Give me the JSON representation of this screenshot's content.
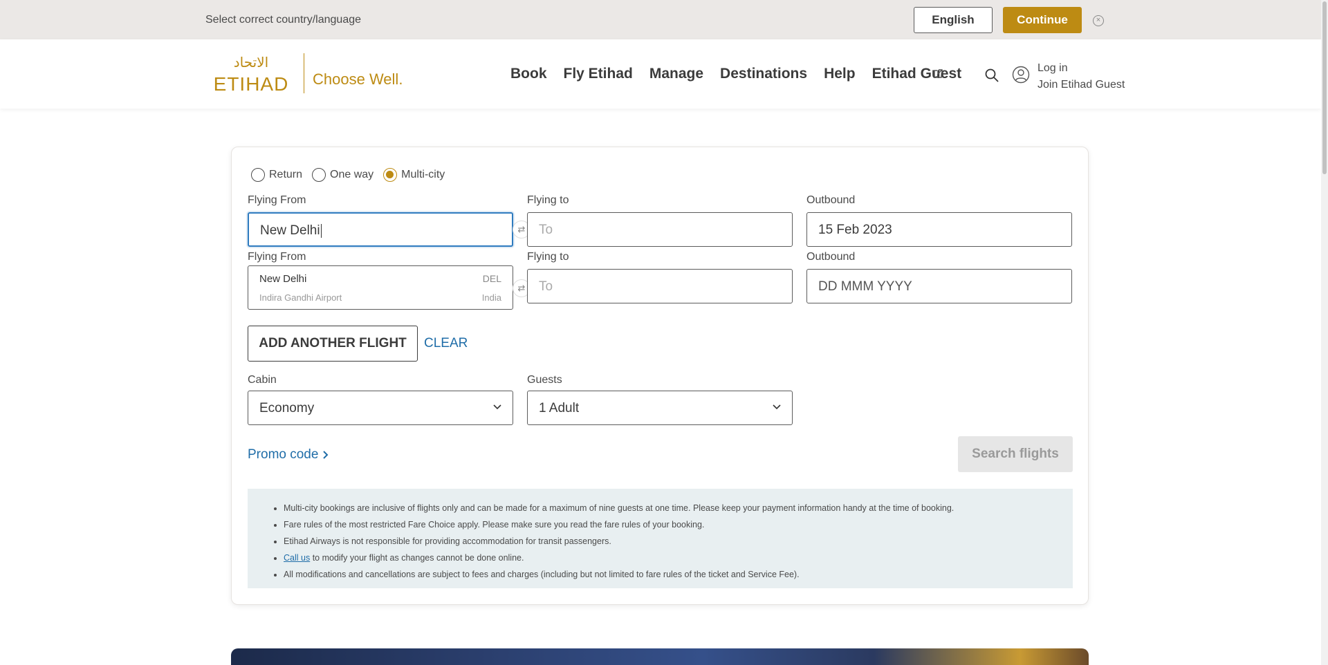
{
  "banner": {
    "message": "Select correct country/language",
    "language_button": "English",
    "continue_button": "Continue"
  },
  "header": {
    "logo_latin": "ETIHAD",
    "logo_arabic": "الاتحاد",
    "tagline": "Choose Well.",
    "nav": [
      "Book",
      "Fly Etihad",
      "Manage",
      "Destinations",
      "Help",
      "Etihad Guest"
    ],
    "login": "Log in",
    "join": "Join Etihad Guest"
  },
  "booking": {
    "trip_types": [
      {
        "label": "Return",
        "selected": false
      },
      {
        "label": "One way",
        "selected": false
      },
      {
        "label": "Multi-city",
        "selected": true
      }
    ],
    "flight1": {
      "from_label": "Flying From",
      "from_value": "New Delhi",
      "to_label": "Flying to",
      "to_placeholder": "To",
      "date_label": "Outbound",
      "date_value": "15 Feb 2023"
    },
    "flight2": {
      "from_label": "Flying From",
      "to_label": "Flying to",
      "to_placeholder": "To",
      "date_label": "Outbound",
      "date_placeholder": "DD MMM YYYY"
    },
    "suggestion": {
      "city": "New Delhi",
      "code": "DEL",
      "airport": "Indira Gandhi Airport",
      "country": "India"
    },
    "add_flight_button": "ADD ANOTHER FLIGHT",
    "clear_link": "CLEAR",
    "cabin_label": "Cabin",
    "cabin_value": "Economy",
    "guests_label": "Guests",
    "guests_value": "1 Adult",
    "promo_link": "Promo code",
    "search_button": "Search flights",
    "notes": [
      "Multi-city bookings are inclusive of flights only and can be made for a maximum of nine guests at one time. Please keep your payment information handy at the time of booking.",
      "Fare rules of the most restricted Fare Choice apply. Please make sure you read the fare rules of your booking.",
      "Etihad Airways is not responsible for providing accommodation for transit passengers."
    ],
    "note_call_link": "Call us",
    "note_call_rest": " to modify your flight as changes cannot be done online.",
    "note_last": "All modifications and cancellations are subject to fees and charges (including but not limited to fare rules of the ticket and Service Fee)."
  },
  "colors": {
    "brand_gold": "#bd8b13",
    "link_blue": "#1f6da8",
    "focus_blue": "#2f7bbf"
  }
}
